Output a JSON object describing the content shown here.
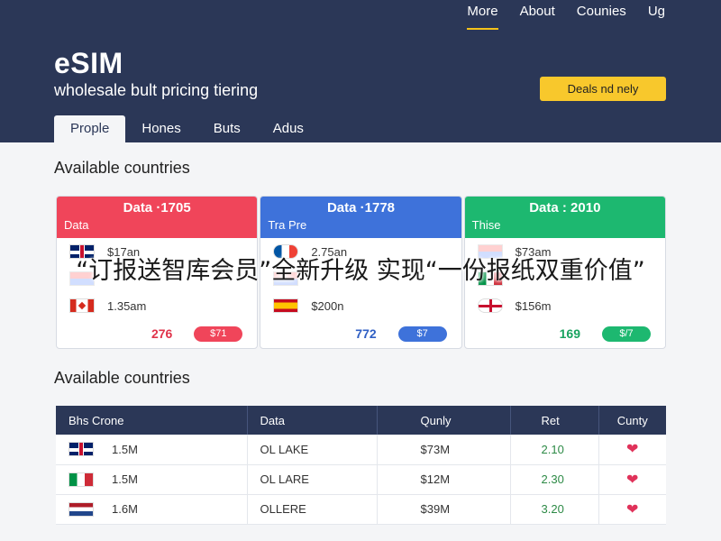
{
  "topnav": [
    "More",
    "About",
    "Counies",
    "Ug"
  ],
  "brand": "eSIM",
  "subtitle": "wholesale bult pricing tiering",
  "cta_label": "Deals nd nely",
  "tabs": [
    "Prople",
    "Hones",
    "Buts",
    "Adus"
  ],
  "section1_title": "Available countries",
  "section2_title": "Available countries",
  "cards": [
    {
      "title": "Data ·1705",
      "subtitle": "Data",
      "color": "#f0455a",
      "rows": [
        {
          "flag": "uk",
          "text": "$17an"
        },
        {
          "flag": "it",
          "text": ""
        },
        {
          "flag": "ca",
          "text": "1.35am"
        }
      ],
      "count": "276",
      "pill": "$71"
    },
    {
      "title": "Data ·1778",
      "subtitle": "Tra Pre",
      "color": "#3e72da",
      "rows": [
        {
          "flag": "fr",
          "text": "2.75an"
        },
        {
          "flag": "gen",
          "text": ""
        },
        {
          "flag": "es",
          "text": "$200n"
        }
      ],
      "count": "772",
      "pill": "$7"
    },
    {
      "title": "Data : 2010",
      "subtitle": "Thise",
      "color": "#1db870",
      "rows": [
        {
          "flag": "gen",
          "text": "$73am"
        },
        {
          "flag": "it",
          "text": ""
        },
        {
          "flag": "gb-circle",
          "text": "$156m"
        }
      ],
      "count": "169",
      "pill": "$/7"
    }
  ],
  "table": {
    "headers": [
      "Bhs Crone",
      "Data",
      "Qunly",
      "Ret",
      "Cunty"
    ],
    "rows": [
      {
        "flag": "uk",
        "country": "1.5M",
        "data": "OL LAKE",
        "qty": "$73M",
        "rate": "2.10"
      },
      {
        "flag": "it",
        "country": "1.5M",
        "data": "OL LARE",
        "qty": "$12M",
        "rate": "2.30"
      },
      {
        "flag": "nl",
        "country": "1.6M",
        "data": "OLLERE",
        "qty": "$39M",
        "rate": "3.20"
      }
    ]
  },
  "overlay_text": "“订报送智库会员”全新升级 实现“一份报纸双重价值”"
}
